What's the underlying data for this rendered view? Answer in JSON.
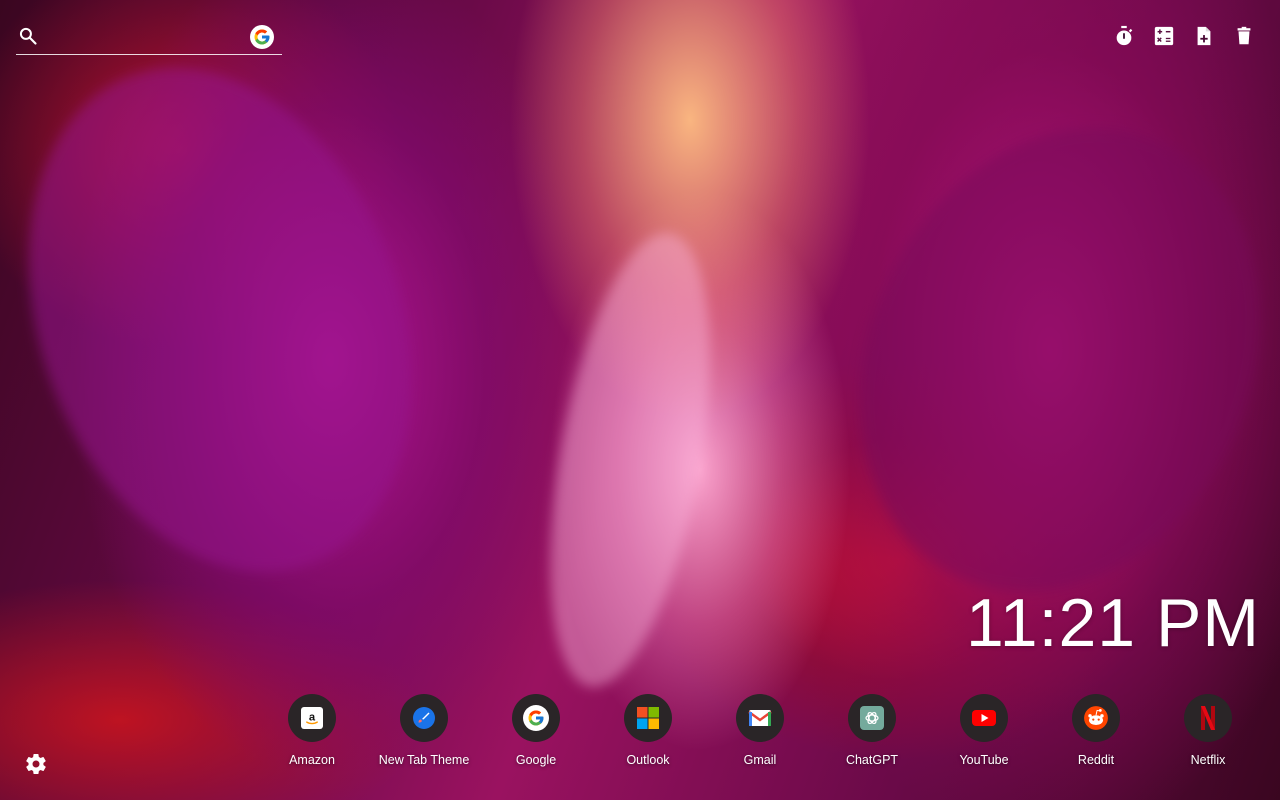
{
  "search": {
    "placeholder": "",
    "engine_icon": "google-g-icon"
  },
  "toolbar": {
    "items": [
      {
        "name": "timer",
        "icon": "stopwatch-icon"
      },
      {
        "name": "calculator",
        "icon": "calculator-icon"
      },
      {
        "name": "new-note",
        "icon": "note-add-icon"
      },
      {
        "name": "trash",
        "icon": "trash-icon"
      }
    ]
  },
  "clock": {
    "time": "11:21 PM"
  },
  "shortcuts": [
    {
      "label": "Amazon",
      "icon": "amazon-icon"
    },
    {
      "label": "New Tab Theme",
      "icon": "paintbrush-icon"
    },
    {
      "label": "Google",
      "icon": "google-icon"
    },
    {
      "label": "Outlook",
      "icon": "microsoft-icon"
    },
    {
      "label": "Gmail",
      "icon": "gmail-icon"
    },
    {
      "label": "ChatGPT",
      "icon": "chatgpt-icon"
    },
    {
      "label": "YouTube",
      "icon": "youtube-icon"
    },
    {
      "label": "Reddit",
      "icon": "reddit-icon"
    },
    {
      "label": "Netflix",
      "icon": "netflix-icon"
    }
  ],
  "settings": {
    "icon": "gear-icon"
  },
  "colors": {
    "text": "#ffffff",
    "tile_bg": "#2a2527",
    "youtube_red": "#ff0000",
    "netflix_red": "#e50914",
    "reddit_orange": "#ff4500",
    "chatgpt_green": "#74aa9c"
  }
}
